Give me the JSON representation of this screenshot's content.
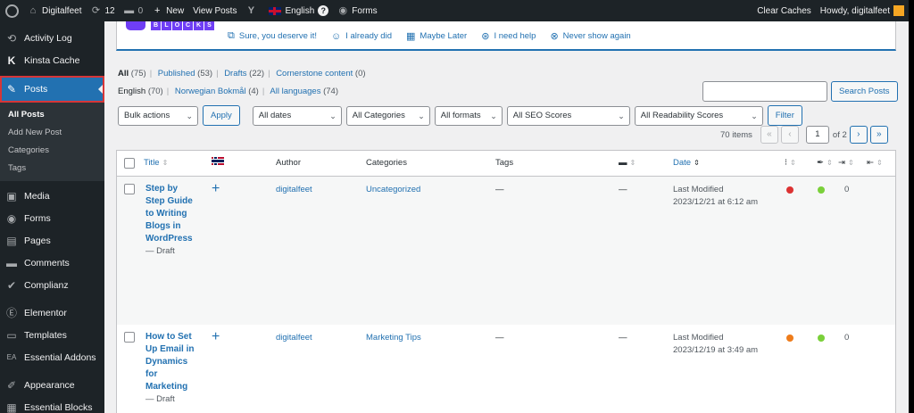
{
  "adminbar": {
    "site_name": "Digitalfeet",
    "updates_count": "12",
    "comments_count": "0",
    "new_label": "New",
    "view_posts": "View Posts",
    "language": "English",
    "forms": "Forms",
    "clear_caches": "Clear Caches",
    "howdy": "Howdy, digitalfeet"
  },
  "sidebar": {
    "items_top": [
      {
        "label": "Activity Log",
        "icon": "history-icon"
      },
      {
        "label": "Kinsta Cache",
        "icon": "kinsta-icon"
      }
    ],
    "active": {
      "label": "Posts",
      "icon": "pushpin-icon"
    },
    "submenu": [
      "All Posts",
      "Add New Post",
      "Categories",
      "Tags"
    ],
    "items_bottom": [
      {
        "label": "Media",
        "icon": "media-icon"
      },
      {
        "label": "Forms",
        "icon": "forms-icon"
      },
      {
        "label": "Pages",
        "icon": "pages-icon"
      },
      {
        "label": "Comments",
        "icon": "comments-icon"
      },
      {
        "label": "Complianz",
        "icon": "check-icon"
      },
      {
        "label": "Elementor",
        "icon": "elementor-icon"
      },
      {
        "label": "Templates",
        "icon": "folder-icon"
      },
      {
        "label": "Essential Addons",
        "icon": "ea-icon"
      },
      {
        "label": "Appearance",
        "icon": "brush-icon"
      },
      {
        "label": "Essential Blocks",
        "icon": "blocks-icon"
      }
    ]
  },
  "notice": {
    "brand_letters": [
      "B",
      "L",
      "O",
      "C",
      "K",
      "S"
    ],
    "actions": [
      {
        "label": "Sure, you deserve it!",
        "icon": "external-link-icon"
      },
      {
        "label": "I already did",
        "icon": "smile-icon"
      },
      {
        "label": "Maybe Later",
        "icon": "calendar-icon"
      },
      {
        "label": "I need help",
        "icon": "help-icon"
      },
      {
        "label": "Never show again",
        "icon": "close-circle-icon"
      }
    ]
  },
  "views": {
    "all": "All",
    "all_count": "(75)",
    "published": "Published",
    "published_count": "(53)",
    "drafts": "Drafts",
    "drafts_count": "(22)",
    "cornerstone": "Cornerstone content",
    "cornerstone_count": "(0)"
  },
  "languages": {
    "english": "English",
    "english_count": "(70)",
    "norwegian": "Norwegian Bokmål",
    "norwegian_count": "(4)",
    "all": "All languages",
    "all_count": "(74)"
  },
  "search": {
    "button": "Search Posts",
    "placeholder": ""
  },
  "filters": {
    "bulk_actions": "Bulk actions",
    "apply": "Apply",
    "dates": "All dates",
    "categories": "All Categories",
    "formats": "All formats",
    "seo": "All SEO Scores",
    "readability": "All Readability Scores",
    "filter": "Filter"
  },
  "pagination": {
    "items": "70 items",
    "first": "«",
    "prev": "‹",
    "current_page": "1",
    "of": "of 2",
    "next": "›",
    "last": "»"
  },
  "table": {
    "headers": {
      "title": "Title",
      "author": "Author",
      "categories": "Categories",
      "tags": "Tags",
      "date": "Date"
    },
    "rows": [
      {
        "title_lines": [
          "Step by",
          "Step Guide",
          "to Writing",
          "Blogs in",
          "WordPress"
        ],
        "state": "— Draft",
        "author": "digitalfeet",
        "category": "Uncategorized",
        "tags": "—",
        "comments": "—",
        "date_status": "Last Modified",
        "date_value": "2023/12/21 at 6:12 am",
        "seo_color": "#dc3232",
        "readability_color": "#7ad03a",
        "links": "0"
      },
      {
        "title_lines": [
          "How to Set",
          "Up Email in",
          "Dynamics",
          "for",
          "Marketing"
        ],
        "state": "— Draft",
        "author": "digitalfeet",
        "category": "Marketing Tips",
        "tags": "—",
        "comments": "—",
        "date_status": "Last Modified",
        "date_value": "2023/12/19 at 3:49 am",
        "seo_color": "#ee7c1b",
        "readability_color": "#7ad03a",
        "links": "0"
      }
    ]
  }
}
